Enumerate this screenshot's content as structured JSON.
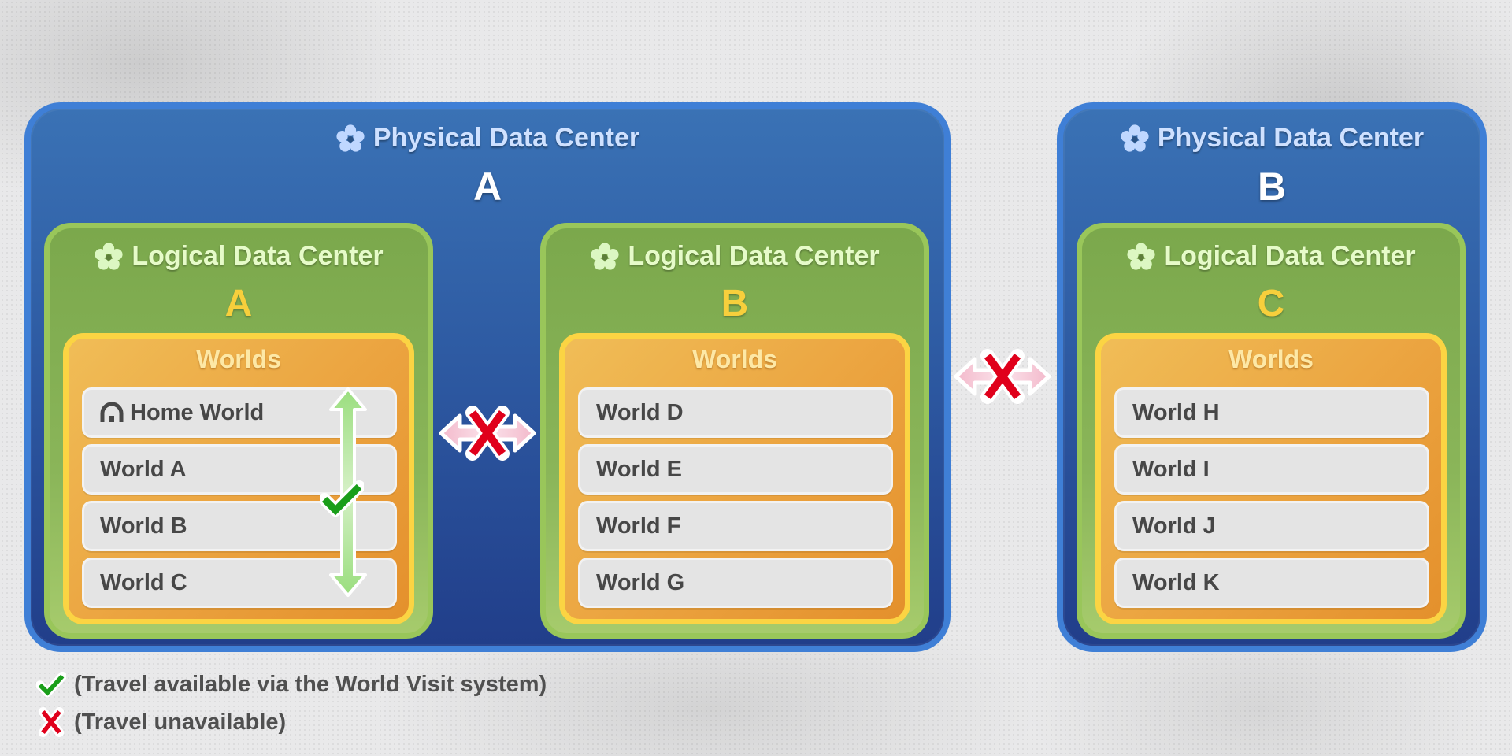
{
  "diagram": {
    "physical_data_centers": [
      {
        "label": "Physical Data Center",
        "letter": "A",
        "icon": "flower-icon",
        "logical_data_centers": [
          {
            "label": "Logical Data Center",
            "letter": "A",
            "icon": "flower-icon",
            "worlds_title": "Worlds",
            "worlds": [
              {
                "name": "Home World",
                "icon": "home-icon"
              },
              {
                "name": "World A"
              },
              {
                "name": "World B"
              },
              {
                "name": "World C"
              }
            ],
            "internal_travel": "available"
          },
          {
            "label": "Logical Data Center",
            "letter": "B",
            "icon": "flower-icon",
            "worlds_title": "Worlds",
            "worlds": [
              {
                "name": "World D"
              },
              {
                "name": "World E"
              },
              {
                "name": "World F"
              },
              {
                "name": "World G"
              }
            ]
          }
        ]
      },
      {
        "label": "Physical Data Center",
        "letter": "B",
        "icon": "flower-icon",
        "logical_data_centers": [
          {
            "label": "Logical Data Center",
            "letter": "C",
            "icon": "flower-icon",
            "worlds_title": "Worlds",
            "worlds": [
              {
                "name": "World H"
              },
              {
                "name": "World I"
              },
              {
                "name": "World J"
              },
              {
                "name": "World K"
              }
            ]
          }
        ]
      }
    ],
    "connections": [
      {
        "from": "Logical Data Center A",
        "to": "Logical Data Center B",
        "status": "unavailable"
      },
      {
        "from": "Physical Data Center A",
        "to": "Physical Data Center B",
        "status": "unavailable"
      },
      {
        "from": "Home World",
        "to": "World C",
        "status": "available"
      }
    ]
  },
  "legend": {
    "available": {
      "icon": "check-icon",
      "text": "(Travel available via the World Visit system)"
    },
    "unavailable": {
      "icon": "cross-icon",
      "text": "(Travel unavailable)"
    }
  },
  "colors": {
    "physical_border": "#3f7fd6",
    "physical_fill": "#2e5ba3",
    "logical_border": "#99c65a",
    "logical_fill": "#8ab559",
    "worlds_border": "#fbd443",
    "worlds_fill": "#eba33f",
    "world_row": "#e4e4e4",
    "check": "#1a9e1a",
    "cross": "#e0001b"
  }
}
